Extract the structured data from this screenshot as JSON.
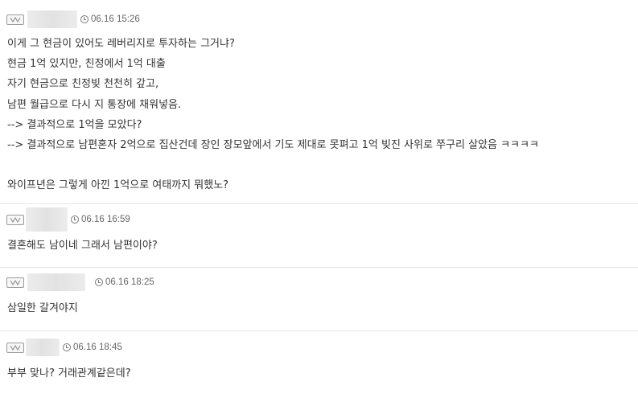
{
  "comments": [
    {
      "time": "06.16 15:26",
      "lines": [
        "이게 그 현금이 있어도 레버리지로 투자하는 그거냐?",
        "현금 1억 있지만, 친정에서 1억 대출",
        "자기 현금으로 친정빚 천천히 갚고,",
        "남편 월급으로 다시 지 통장에 채워넣음.",
        "--> 결과적으로 1억을 모았다?",
        "--> 결과적으로 남편혼자 2억으로 집산건데 장인 장모앞에서 기도 제대로 못펴고 1억 빚진 사위로 쭈구리 살았음 ㅋㅋㅋㅋ",
        "",
        "와이프년은 그렇게 아낀 1억으로 여태까지 뭐했노?"
      ]
    },
    {
      "time": "06.16 16:59",
      "lines": [
        "결혼해도 남이네 그래서 남편이야?"
      ]
    },
    {
      "time": "06.16 18:25",
      "lines": [
        "삼일한 갈겨야지"
      ]
    },
    {
      "time": "06.16 18:45",
      "lines": [
        "부부 맞나? 거래관계같은데?"
      ]
    }
  ],
  "colors": {
    "text": "#333333",
    "meta": "#666666",
    "divider": "#e6e6e6",
    "blur": "#e6e6e6"
  },
  "icons": {
    "level": "level-badge-icon",
    "time": "clock-icon"
  }
}
